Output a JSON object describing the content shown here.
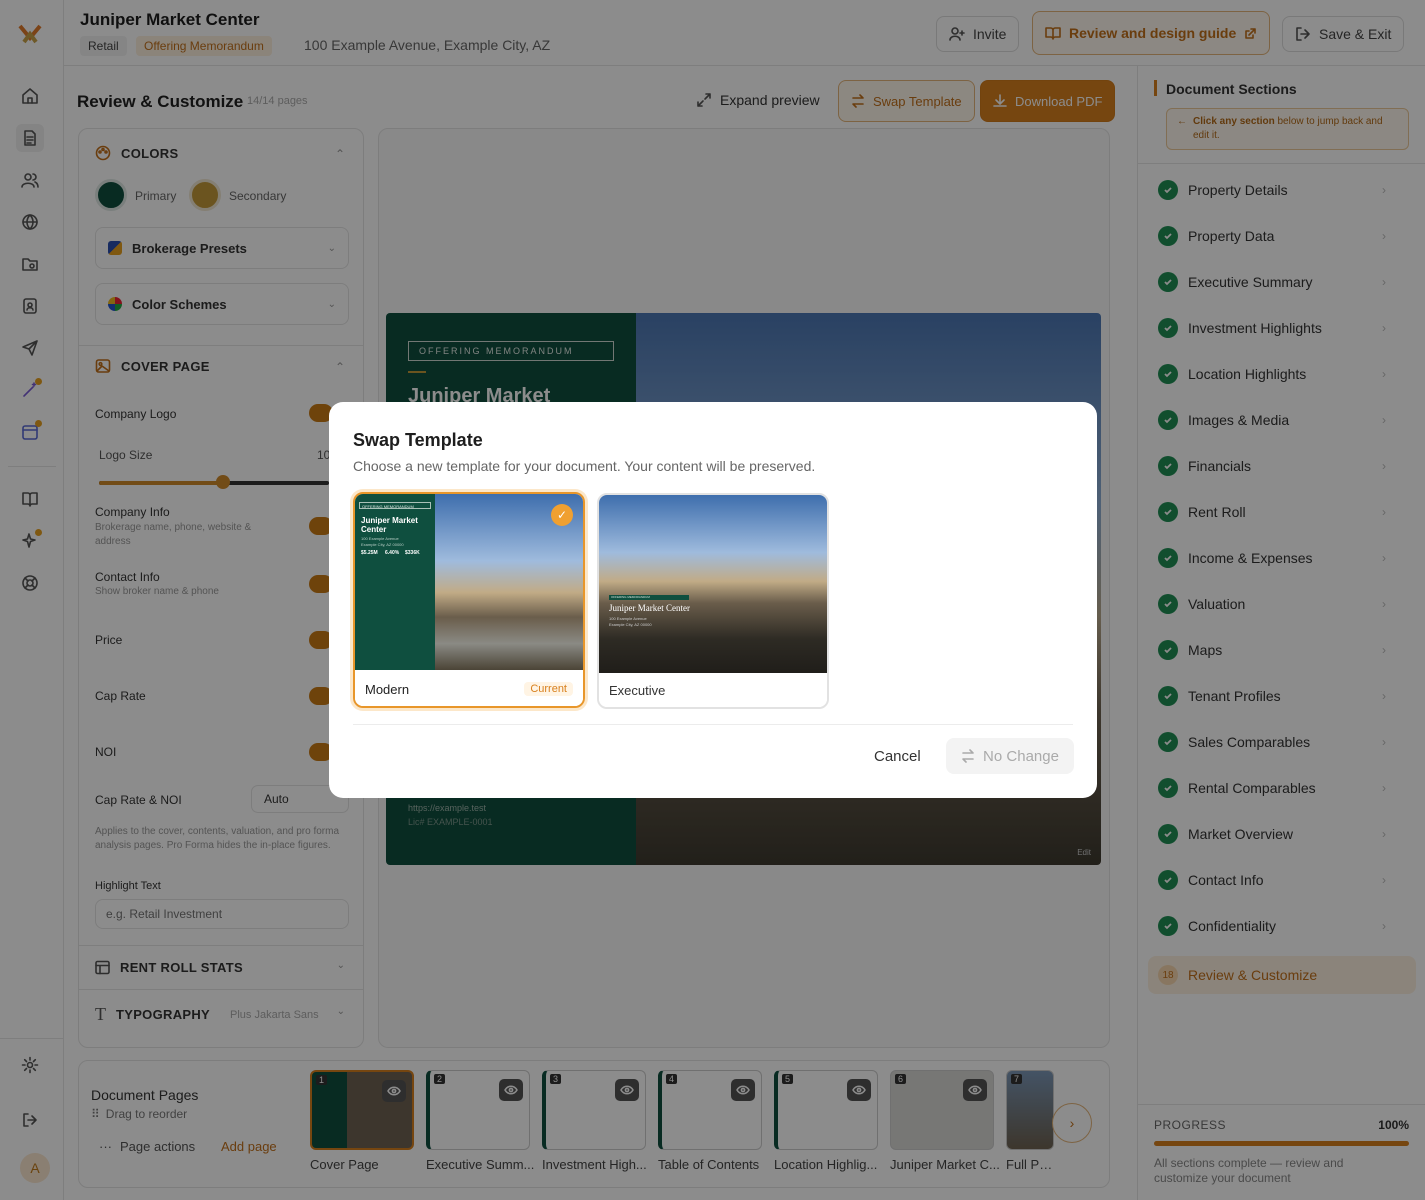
{
  "header": {
    "title": "Juniper Market Center",
    "tag_type": "Retail",
    "tag_doc": "Offering Memorandum",
    "address": "100 Example Avenue, Example City, AZ",
    "invite": "Invite",
    "guide": "Review and design guide",
    "save": "Save & Exit"
  },
  "rail": {
    "avatar": "A"
  },
  "left": {
    "title": "Review & Customize",
    "pages": "14/14 pages",
    "colors": {
      "title": "COLORS",
      "primary": "Primary",
      "secondary": "Secondary",
      "primary_color": "#0f4f3f",
      "secondary_color": "#c49a3a",
      "presets": "Brokerage Presets",
      "schemes": "Color Schemes"
    },
    "cover": {
      "title": "COVER PAGE",
      "company_logo": "Company Logo",
      "logo_size": "Logo Size",
      "logo_size_val": "10",
      "company_info": "Company Info",
      "company_info_sub": "Brokerage name, phone, website & address",
      "contact_info": "Contact Info",
      "contact_info_sub": "Show broker name & phone",
      "price": "Price",
      "cap_rate": "Cap Rate",
      "noi": "NOI",
      "cap_noi": "Cap Rate & NOI",
      "cap_noi_val": "Auto",
      "cap_noi_note": "Applies to the cover, contents, valuation, and pro forma analysis pages. Pro Forma hides the in-place figures.",
      "highlight": "Highlight Text",
      "highlight_ph": "e.g. Retail Investment"
    },
    "rentroll": "RENT ROLL STATS",
    "typography": "TYPOGRAPHY",
    "typography_font": "Plus Jakarta Sans"
  },
  "preview": {
    "expand": "Expand preview",
    "swap": "Swap Template",
    "download": "Download PDF",
    "om_label": "OFFERING MEMORANDUM",
    "doc_title": "Juniper Market",
    "url": "https://example.test",
    "lic": "Lic# EXAMPLE-0001",
    "edit": "Edit"
  },
  "sections": {
    "title": "Document Sections",
    "hint_bold": "Click any section",
    "hint_rest": " below to jump back and edit it.",
    "items": [
      "Property Details",
      "Property Data",
      "Executive Summary",
      "Investment Highlights",
      "Location Highlights",
      "Images & Media",
      "Financials",
      "Rent Roll",
      "Income & Expenses",
      "Valuation",
      "Maps",
      "Tenant Profiles",
      "Sales Comparables",
      "Rental Comparables",
      "Market Overview",
      "Contact Info",
      "Confidentiality"
    ],
    "current": {
      "num": "18",
      "label": "Review & Customize"
    },
    "progress_label": "PROGRESS",
    "progress_val": "100%",
    "progress_fraction": 1.0,
    "progress_note": "All sections complete — review and customize your document"
  },
  "pages": {
    "title": "Document Pages",
    "drag": "Drag to reorder",
    "actions": "Page actions",
    "add": "Add page",
    "thumbs": [
      {
        "n": "1",
        "label": "Cover Page"
      },
      {
        "n": "2",
        "label": "Executive Summ..."
      },
      {
        "n": "3",
        "label": "Investment High..."
      },
      {
        "n": "4",
        "label": "Table of Contents"
      },
      {
        "n": "5",
        "label": "Location Highlig..."
      },
      {
        "n": "6",
        "label": "Juniper Market C..."
      },
      {
        "n": "7",
        "label": "Full Page"
      }
    ]
  },
  "modal": {
    "title": "Swap Template",
    "subtitle": "Choose a new template for your document. Your content will be preserved.",
    "t1": {
      "name": "Modern",
      "badge": "Current",
      "om": "OFFERING MEMORANDUM",
      "title": "Juniper Market Center",
      "addr1": "100 Example Avenue",
      "addr2": "Example City, AZ 00000",
      "s1": "$5.25M",
      "s2": "6.40%",
      "s3": "$336K"
    },
    "t2": {
      "name": "Executive",
      "om": "OFFERING MEMORANDUM",
      "title": "Juniper Market Center",
      "addr1": "100 Example Avenue",
      "addr2": "Example City, AZ 00000"
    },
    "cancel": "Cancel",
    "confirm": "No Change"
  }
}
